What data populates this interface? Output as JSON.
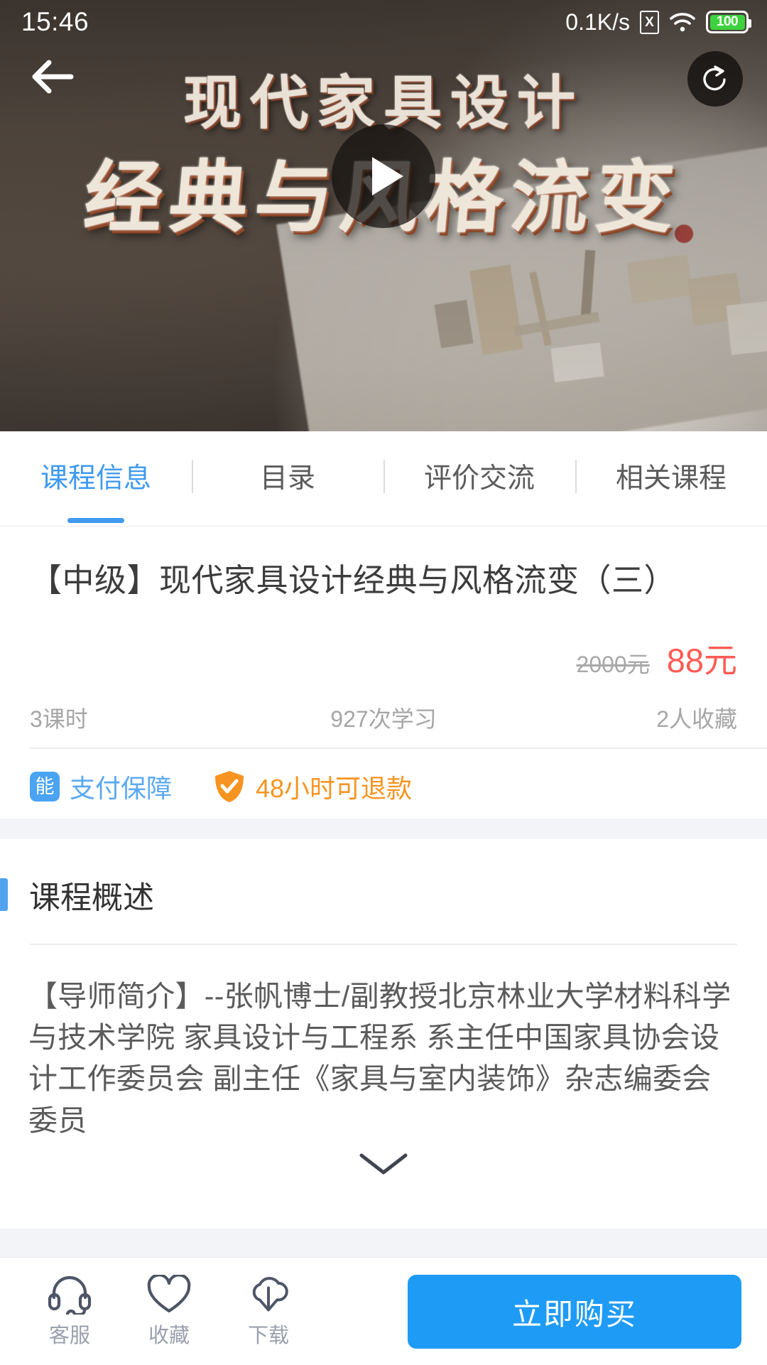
{
  "statusbar": {
    "time": "15:46",
    "network_speed": "0.1K/s",
    "sim_icon": "sim-card-disabled-icon",
    "sim_glyph": "X",
    "wifi_icon": "wifi-icon",
    "battery_icon": "battery-icon",
    "battery_level": "100"
  },
  "banner": {
    "title_line1": "现代家具设计",
    "title_line2": "经典与风格流变",
    "back_icon": "back-arrow-icon",
    "share_icon": "share-icon",
    "play_icon": "play-icon"
  },
  "tabs": [
    {
      "label": "课程信息",
      "active": true
    },
    {
      "label": "目录",
      "active": false
    },
    {
      "label": "评价交流",
      "active": false
    },
    {
      "label": "相关课程",
      "active": false
    }
  ],
  "course": {
    "title": "【中级】现代家具设计经典与风格流变（三）",
    "price_original": "2000元",
    "price_current": "88元",
    "stats": {
      "lessons": "3课时",
      "views": "927次学习",
      "favorites": "2人收藏"
    },
    "badges": {
      "pay_icon_glyph": "能",
      "pay_label": "支付保障",
      "refund_icon": "shield-check-icon",
      "refund_label": "48小时可退款"
    }
  },
  "overview": {
    "section_title": "课程概述",
    "body": "【导师简介】--张帆博士/副教授北京林业大学材料科学与技术学院 家具设计与工程系 系主任中国家具协会设计工作委员会 副主任《家具与室内装饰》杂志编委会委员",
    "expand_icon": "chevron-down-icon"
  },
  "bottombar": {
    "actions": [
      {
        "icon": "headset-icon",
        "label": "客服"
      },
      {
        "icon": "heart-icon",
        "label": "收藏"
      },
      {
        "icon": "cloud-download-icon",
        "label": "下载"
      }
    ],
    "buy_label": "立即购买"
  },
  "colors": {
    "accent_blue": "#1e9bf5",
    "tab_active": "#3f9af0",
    "price_red": "#ff5b55",
    "refund_orange": "#f79421",
    "pay_blue": "#5aa9f0",
    "battery_green": "#3ed13e",
    "spacer_gray": "#f2f4f7"
  }
}
